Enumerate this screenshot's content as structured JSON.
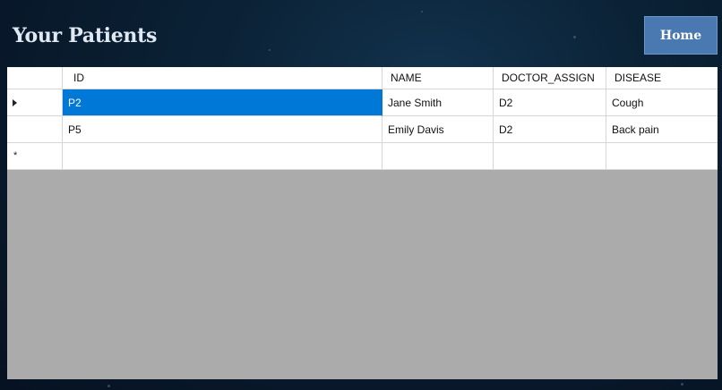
{
  "page": {
    "title": "Your Patients",
    "home_label": "Home"
  },
  "grid": {
    "columns": [
      "ID",
      "NAME",
      "DOCTOR_ASSIGN",
      "DISEASE"
    ],
    "rows": [
      {
        "id": "P2",
        "name": "Jane Smith",
        "doctor_assign": "D2",
        "disease": "Cough",
        "selected": true
      },
      {
        "id": "P5",
        "name": "Emily Davis",
        "doctor_assign": "D2",
        "disease": "Back pain",
        "selected": false
      }
    ],
    "new_row_marker": "*"
  },
  "colors": {
    "selection": "#0078d7",
    "grid_background": "#ababab",
    "button": "#4a78b0"
  },
  "icons": {
    "current_row": "current-row-arrow-icon",
    "new_row": "new-row-asterisk-icon"
  }
}
